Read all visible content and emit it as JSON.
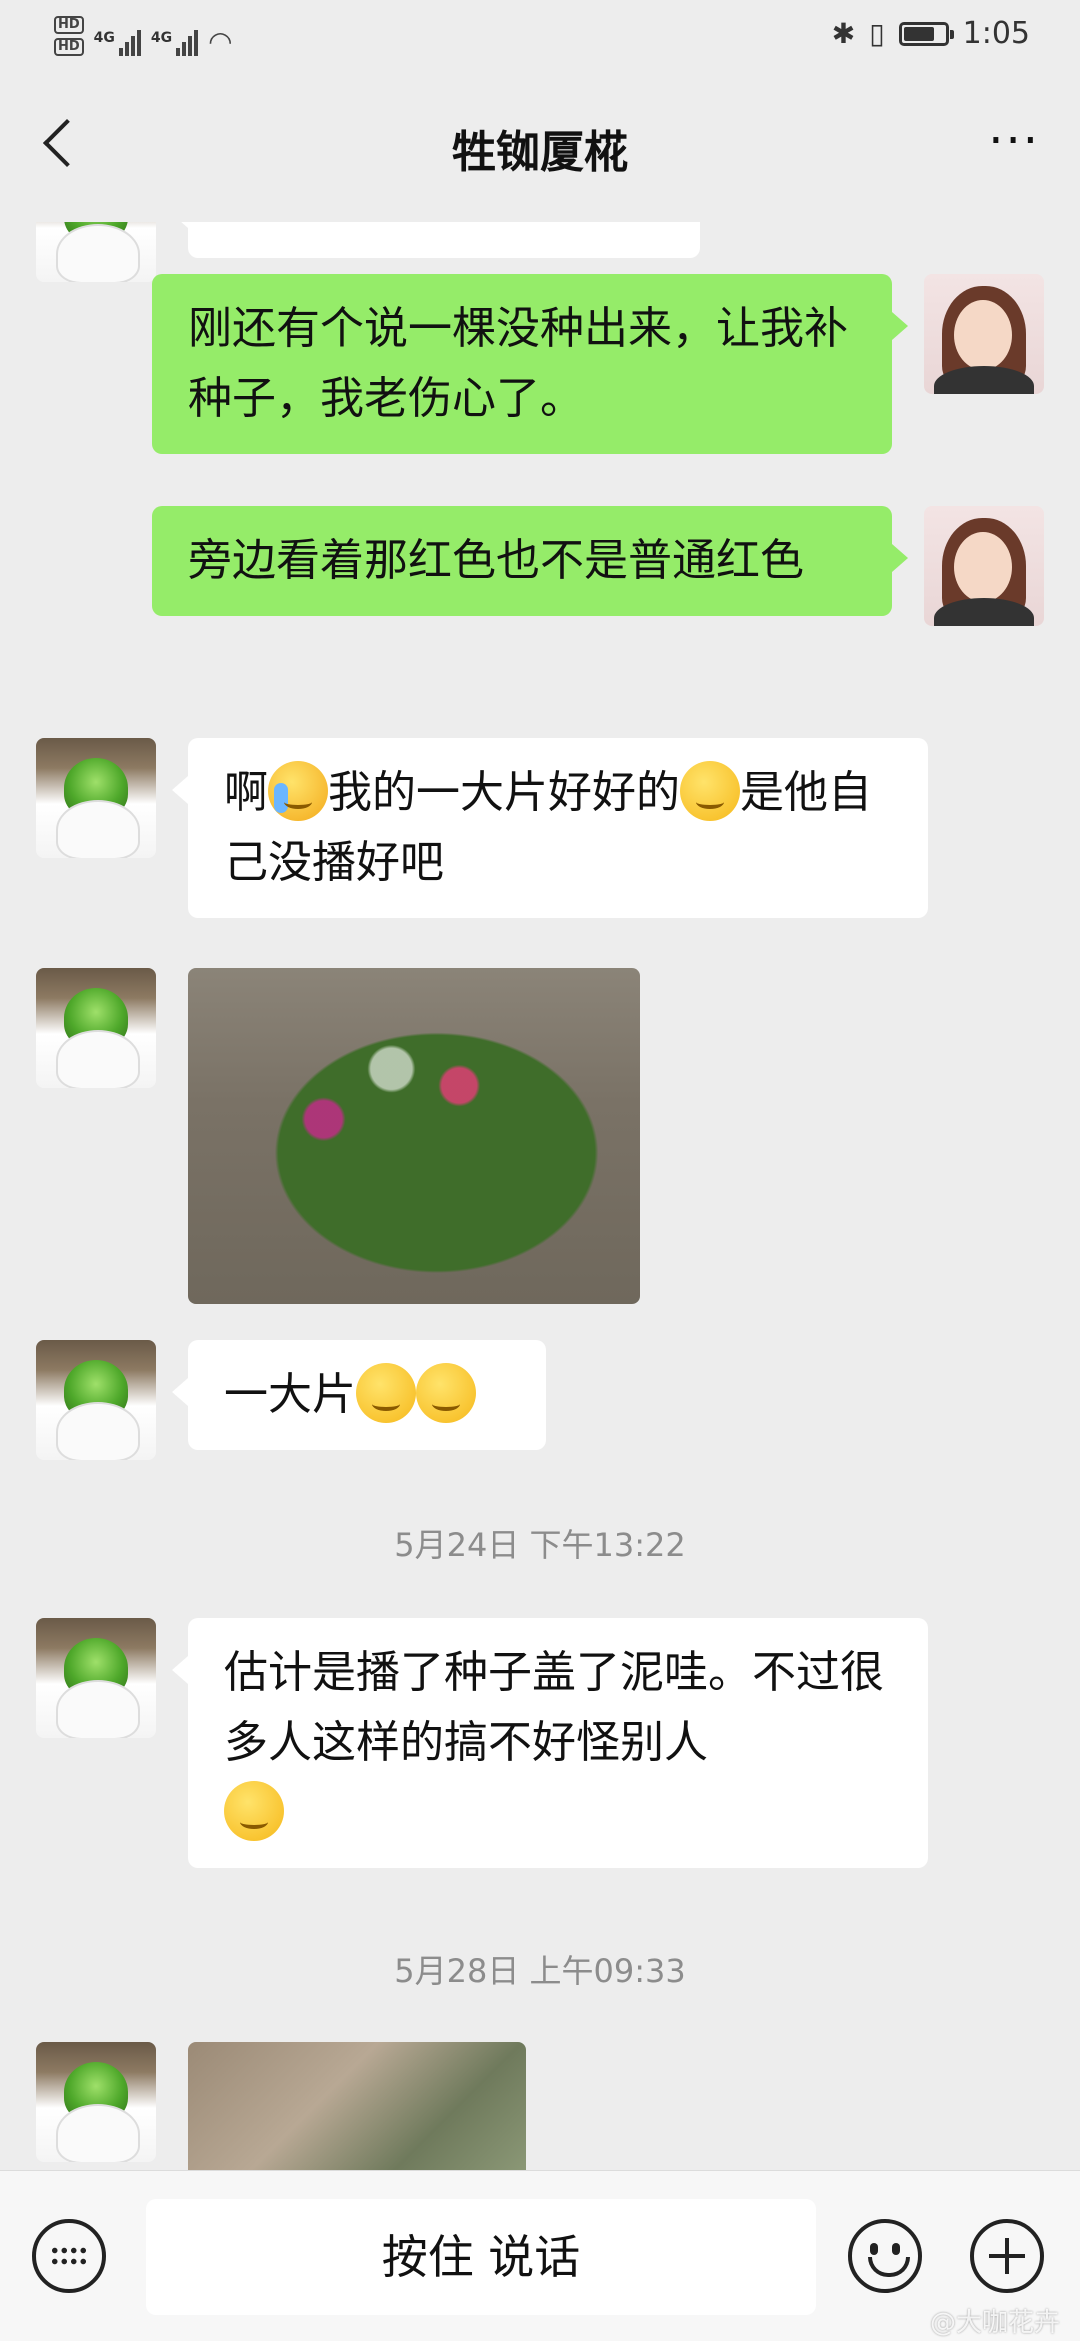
{
  "status_bar": {
    "network_1": "4G",
    "network_2": "4G",
    "hd_1": "HD",
    "hd_2": "HD",
    "time": "1:05"
  },
  "header": {
    "title": "牲铷厦椛",
    "more": "···"
  },
  "messages": [
    {
      "side": "out",
      "text": "刚还有个说一棵没种出来，让我补种子，我老伤心了。"
    },
    {
      "side": "out",
      "text": "旁边看着那红色也不是普通红色"
    },
    {
      "side": "in",
      "text_1": "啊",
      "text_2": "我的一大片好好的",
      "text_3": "是他自己没播好吧"
    },
    {
      "side": "in",
      "type": "image"
    },
    {
      "side": "in",
      "text": "一大片"
    },
    {
      "side": "in",
      "text": "估计是播了种子盖了泥哇。不过很多人这样的搞不好怪别人"
    },
    {
      "side": "in",
      "type": "image"
    }
  ],
  "timestamps": [
    "5月24日 下午13:22",
    "5月28日 上午09:33"
  ],
  "input_bar": {
    "hold_to_talk": "按住 说话"
  },
  "watermark": "@大咖花卉"
}
